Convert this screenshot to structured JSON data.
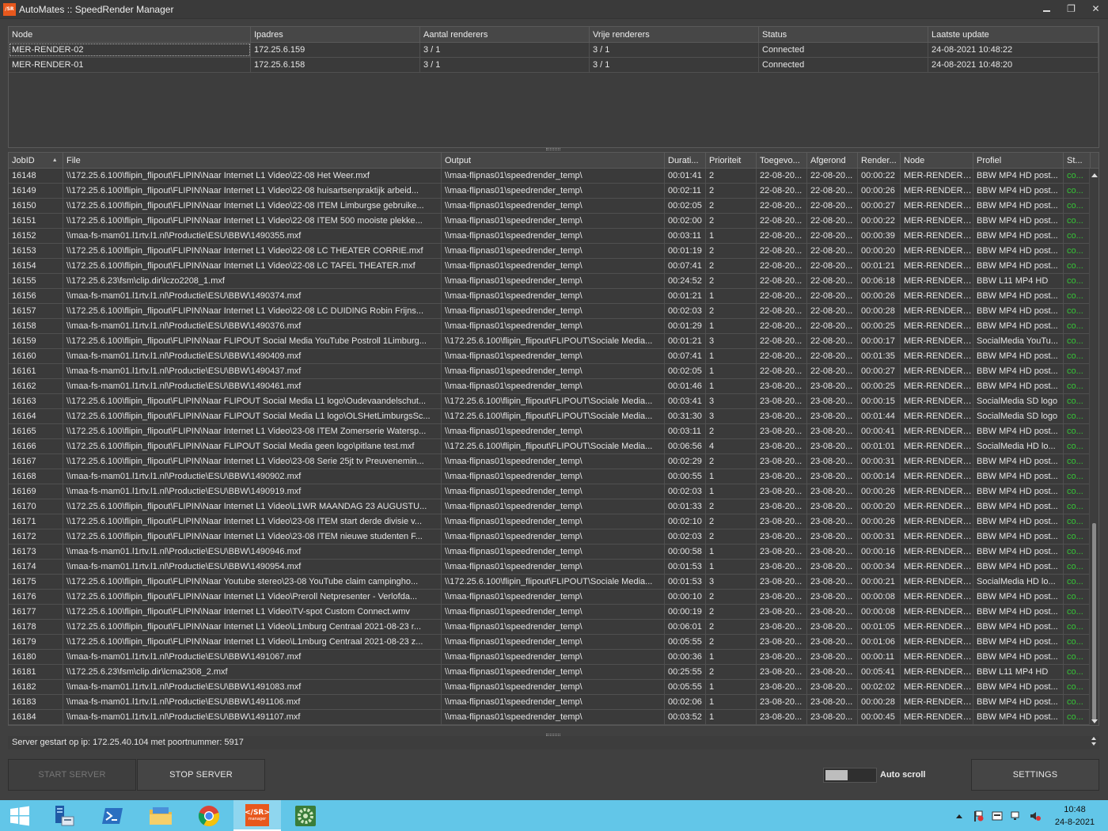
{
  "window": {
    "app_icon_text": "/SR",
    "title": "AutoMates :: SpeedRender Manager",
    "minimize": "—",
    "restore": "❐",
    "close": "✕"
  },
  "nodes": {
    "columns": [
      "Node",
      "Ipadres",
      "Aantal renderers",
      "Vrije renderers",
      "Status",
      "Laatste update"
    ],
    "rows": [
      [
        "MER-RENDER-02",
        "172.25.6.159",
        "3 / 1",
        "3 / 1",
        "Connected",
        "24-08-2021 10:48:22"
      ],
      [
        "MER-RENDER-01",
        "172.25.6.158",
        "3 / 1",
        "3 / 1",
        "Connected",
        "24-08-2021 10:48:20"
      ]
    ]
  },
  "jobs": {
    "sort_icon": "▲",
    "columns": [
      "JobID",
      "File",
      "Output",
      "Durati...",
      "Prioriteit",
      "Toegevo...",
      "Afgerond",
      "Render...",
      "Node",
      "Profiel",
      "St..."
    ],
    "rows": [
      [
        "16148",
        "\\\\172.25.6.100\\flipin_flipout\\FLIPIN\\Naar Internet L1 Video\\22-08 Het Weer.mxf",
        "\\\\maa-flipnas01\\speedrender_temp\\",
        "00:01:41",
        "2",
        "22-08-20...",
        "22-08-20...",
        "00:00:22",
        "MER-RENDER-...",
        "BBW MP4 HD post...",
        "co..."
      ],
      [
        "16149",
        "\\\\172.25.6.100\\flipin_flipout\\FLIPIN\\Naar Internet L1 Video\\22-08 huisartsenpraktijk arbeid...",
        "\\\\maa-flipnas01\\speedrender_temp\\",
        "00:02:11",
        "2",
        "22-08-20...",
        "22-08-20...",
        "00:00:26",
        "MER-RENDER-...",
        "BBW MP4 HD post...",
        "co..."
      ],
      [
        "16150",
        "\\\\172.25.6.100\\flipin_flipout\\FLIPIN\\Naar Internet L1 Video\\22-08 ITEM Limburgse gebruike...",
        "\\\\maa-flipnas01\\speedrender_temp\\",
        "00:02:05",
        "2",
        "22-08-20...",
        "22-08-20...",
        "00:00:27",
        "MER-RENDER-...",
        "BBW MP4 HD post...",
        "co..."
      ],
      [
        "16151",
        "\\\\172.25.6.100\\flipin_flipout\\FLIPIN\\Naar Internet L1 Video\\22-08 ITEM 500 mooiste plekke...",
        "\\\\maa-flipnas01\\speedrender_temp\\",
        "00:02:00",
        "2",
        "22-08-20...",
        "22-08-20...",
        "00:00:22",
        "MER-RENDER-...",
        "BBW MP4 HD post...",
        "co..."
      ],
      [
        "16152",
        "\\\\maa-fs-mam01.l1rtv.l1.nl\\Productie\\ESU\\BBW\\1490355.mxf",
        "\\\\maa-flipnas01\\speedrender_temp\\",
        "00:03:11",
        "1",
        "22-08-20...",
        "22-08-20...",
        "00:00:39",
        "MER-RENDER-...",
        "BBW MP4 HD post...",
        "co..."
      ],
      [
        "16153",
        "\\\\172.25.6.100\\flipin_flipout\\FLIPIN\\Naar Internet L1 Video\\22-08 LC THEATER CORRIE.mxf",
        "\\\\maa-flipnas01\\speedrender_temp\\",
        "00:01:19",
        "2",
        "22-08-20...",
        "22-08-20...",
        "00:00:20",
        "MER-RENDER-...",
        "BBW MP4 HD post...",
        "co..."
      ],
      [
        "16154",
        "\\\\172.25.6.100\\flipin_flipout\\FLIPIN\\Naar Internet L1 Video\\22-08 LC TAFEL THEATER.mxf",
        "\\\\maa-flipnas01\\speedrender_temp\\",
        "00:07:41",
        "2",
        "22-08-20...",
        "22-08-20...",
        "00:01:21",
        "MER-RENDER-...",
        "BBW MP4 HD post...",
        "co..."
      ],
      [
        "16155",
        "\\\\172.25.6.23\\fsm\\clip.dir\\lczo2208_1.mxf",
        "\\\\maa-flipnas01\\speedrender_temp\\",
        "00:24:52",
        "2",
        "22-08-20...",
        "22-08-20...",
        "00:06:18",
        "MER-RENDER-...",
        "BBW L11 MP4 HD",
        "co..."
      ],
      [
        "16156",
        "\\\\maa-fs-mam01.l1rtv.l1.nl\\Productie\\ESU\\BBW\\1490374.mxf",
        "\\\\maa-flipnas01\\speedrender_temp\\",
        "00:01:21",
        "1",
        "22-08-20...",
        "22-08-20...",
        "00:00:26",
        "MER-RENDER-...",
        "BBW MP4 HD post...",
        "co..."
      ],
      [
        "16157",
        "\\\\172.25.6.100\\flipin_flipout\\FLIPIN\\Naar Internet L1 Video\\22-08 LC DUIDING Robin Frijns...",
        "\\\\maa-flipnas01\\speedrender_temp\\",
        "00:02:03",
        "2",
        "22-08-20...",
        "22-08-20...",
        "00:00:28",
        "MER-RENDER-...",
        "BBW MP4 HD post...",
        "co..."
      ],
      [
        "16158",
        "\\\\maa-fs-mam01.l1rtv.l1.nl\\Productie\\ESU\\BBW\\1490376.mxf",
        "\\\\maa-flipnas01\\speedrender_temp\\",
        "00:01:29",
        "1",
        "22-08-20...",
        "22-08-20...",
        "00:00:25",
        "MER-RENDER-...",
        "BBW MP4 HD post...",
        "co..."
      ],
      [
        "16159",
        "\\\\172.25.6.100\\flipin_flipout\\FLIPIN\\Naar FLIPOUT Social Media YouTube Postroll 1Limburg...",
        "\\\\172.25.6.100\\flipin_flipout\\FLIPOUT\\Sociale Media...",
        "00:01:21",
        "3",
        "22-08-20...",
        "22-08-20...",
        "00:00:17",
        "MER-RENDER-...",
        "SocialMedia YouTu...",
        "co..."
      ],
      [
        "16160",
        "\\\\maa-fs-mam01.l1rtv.l1.nl\\Productie\\ESU\\BBW\\1490409.mxf",
        "\\\\maa-flipnas01\\speedrender_temp\\",
        "00:07:41",
        "1",
        "22-08-20...",
        "22-08-20...",
        "00:01:35",
        "MER-RENDER-...",
        "BBW MP4 HD post...",
        "co..."
      ],
      [
        "16161",
        "\\\\maa-fs-mam01.l1rtv.l1.nl\\Productie\\ESU\\BBW\\1490437.mxf",
        "\\\\maa-flipnas01\\speedrender_temp\\",
        "00:02:05",
        "1",
        "22-08-20...",
        "22-08-20...",
        "00:00:27",
        "MER-RENDER-...",
        "BBW MP4 HD post...",
        "co..."
      ],
      [
        "16162",
        "\\\\maa-fs-mam01.l1rtv.l1.nl\\Productie\\ESU\\BBW\\1490461.mxf",
        "\\\\maa-flipnas01\\speedrender_temp\\",
        "00:01:46",
        "1",
        "23-08-20...",
        "23-08-20...",
        "00:00:25",
        "MER-RENDER-...",
        "BBW MP4 HD post...",
        "co..."
      ],
      [
        "16163",
        "\\\\172.25.6.100\\flipin_flipout\\FLIPIN\\Naar FLIPOUT Social Media L1 logo\\Oudevaandelschut...",
        "\\\\172.25.6.100\\flipin_flipout\\FLIPOUT\\Sociale Media...",
        "00:03:41",
        "3",
        "23-08-20...",
        "23-08-20...",
        "00:00:15",
        "MER-RENDER-...",
        "SocialMedia SD logo",
        "co..."
      ],
      [
        "16164",
        "\\\\172.25.6.100\\flipin_flipout\\FLIPIN\\Naar FLIPOUT Social Media L1 logo\\OLSHetLimburgsSc...",
        "\\\\172.25.6.100\\flipin_flipout\\FLIPOUT\\Sociale Media...",
        "00:31:30",
        "3",
        "23-08-20...",
        "23-08-20...",
        "00:01:44",
        "MER-RENDER-...",
        "SocialMedia SD logo",
        "co..."
      ],
      [
        "16165",
        "\\\\172.25.6.100\\flipin_flipout\\FLIPIN\\Naar Internet L1 Video\\23-08 ITEM Zomerserie Watersp...",
        "\\\\maa-flipnas01\\speedrender_temp\\",
        "00:03:11",
        "2",
        "23-08-20...",
        "23-08-20...",
        "00:00:41",
        "MER-RENDER-...",
        "BBW MP4 HD post...",
        "co..."
      ],
      [
        "16166",
        "\\\\172.25.6.100\\flipin_flipout\\FLIPIN\\Naar FLIPOUT Social Media geen logo\\pitlane test.mxf",
        "\\\\172.25.6.100\\flipin_flipout\\FLIPOUT\\Sociale Media...",
        "00:06:56",
        "4",
        "23-08-20...",
        "23-08-20...",
        "00:01:01",
        "MER-RENDER-...",
        "SocialMedia HD lo...",
        "co..."
      ],
      [
        "16167",
        "\\\\172.25.6.100\\flipin_flipout\\FLIPIN\\Naar Internet L1 Video\\23-08 Serie 25jt tv Preuvenemin...",
        "\\\\maa-flipnas01\\speedrender_temp\\",
        "00:02:29",
        "2",
        "23-08-20...",
        "23-08-20...",
        "00:00:31",
        "MER-RENDER-...",
        "BBW MP4 HD post...",
        "co..."
      ],
      [
        "16168",
        "\\\\maa-fs-mam01.l1rtv.l1.nl\\Productie\\ESU\\BBW\\1490902.mxf",
        "\\\\maa-flipnas01\\speedrender_temp\\",
        "00:00:55",
        "1",
        "23-08-20...",
        "23-08-20...",
        "00:00:14",
        "MER-RENDER-...",
        "BBW MP4 HD post...",
        "co..."
      ],
      [
        "16169",
        "\\\\maa-fs-mam01.l1rtv.l1.nl\\Productie\\ESU\\BBW\\1490919.mxf",
        "\\\\maa-flipnas01\\speedrender_temp\\",
        "00:02:03",
        "1",
        "23-08-20...",
        "23-08-20...",
        "00:00:26",
        "MER-RENDER-...",
        "BBW MP4 HD post...",
        "co..."
      ],
      [
        "16170",
        "\\\\172.25.6.100\\flipin_flipout\\FLIPIN\\Naar Internet L1 Video\\L1WR MAANDAG 23 AUGUSTU...",
        "\\\\maa-flipnas01\\speedrender_temp\\",
        "00:01:33",
        "2",
        "23-08-20...",
        "23-08-20...",
        "00:00:20",
        "MER-RENDER-...",
        "BBW MP4 HD post...",
        "co..."
      ],
      [
        "16171",
        "\\\\172.25.6.100\\flipin_flipout\\FLIPIN\\Naar Internet L1 Video\\23-08 ITEM start derde divisie v...",
        "\\\\maa-flipnas01\\speedrender_temp\\",
        "00:02:10",
        "2",
        "23-08-20...",
        "23-08-20...",
        "00:00:26",
        "MER-RENDER-...",
        "BBW MP4 HD post...",
        "co..."
      ],
      [
        "16172",
        "\\\\172.25.6.100\\flipin_flipout\\FLIPIN\\Naar Internet L1 Video\\23-08 ITEM nieuwe studenten F...",
        "\\\\maa-flipnas01\\speedrender_temp\\",
        "00:02:03",
        "2",
        "23-08-20...",
        "23-08-20...",
        "00:00:31",
        "MER-RENDER-...",
        "BBW MP4 HD post...",
        "co..."
      ],
      [
        "16173",
        "\\\\maa-fs-mam01.l1rtv.l1.nl\\Productie\\ESU\\BBW\\1490946.mxf",
        "\\\\maa-flipnas01\\speedrender_temp\\",
        "00:00:58",
        "1",
        "23-08-20...",
        "23-08-20...",
        "00:00:16",
        "MER-RENDER-...",
        "BBW MP4 HD post...",
        "co..."
      ],
      [
        "16174",
        "\\\\maa-fs-mam01.l1rtv.l1.nl\\Productie\\ESU\\BBW\\1490954.mxf",
        "\\\\maa-flipnas01\\speedrender_temp\\",
        "00:01:53",
        "1",
        "23-08-20...",
        "23-08-20...",
        "00:00:34",
        "MER-RENDER-...",
        "BBW MP4 HD post...",
        "co..."
      ],
      [
        "16175",
        "\\\\172.25.6.100\\flipin_flipout\\FLIPIN\\Naar Youtube stereo\\23-08 YouTube claim campingho...",
        "\\\\172.25.6.100\\flipin_flipout\\FLIPOUT\\Sociale Media...",
        "00:01:53",
        "3",
        "23-08-20...",
        "23-08-20...",
        "00:00:21",
        "MER-RENDER-...",
        "SocialMedia HD lo...",
        "co..."
      ],
      [
        "16176",
        "\\\\172.25.6.100\\flipin_flipout\\FLIPIN\\Naar Internet L1 Video\\Preroll Netpresenter - Verlofda...",
        "\\\\maa-flipnas01\\speedrender_temp\\",
        "00:00:10",
        "2",
        "23-08-20...",
        "23-08-20...",
        "00:00:08",
        "MER-RENDER-...",
        "BBW MP4 HD post...",
        "co..."
      ],
      [
        "16177",
        "\\\\172.25.6.100\\flipin_flipout\\FLIPIN\\Naar Internet L1 Video\\TV-spot Custom Connect.wmv",
        "\\\\maa-flipnas01\\speedrender_temp\\",
        "00:00:19",
        "2",
        "23-08-20...",
        "23-08-20...",
        "00:00:08",
        "MER-RENDER-...",
        "BBW MP4 HD post...",
        "co..."
      ],
      [
        "16178",
        "\\\\172.25.6.100\\flipin_flipout\\FLIPIN\\Naar Internet L1 Video\\L1mburg Centraal 2021-08-23 r...",
        "\\\\maa-flipnas01\\speedrender_temp\\",
        "00:06:01",
        "2",
        "23-08-20...",
        "23-08-20...",
        "00:01:05",
        "MER-RENDER-...",
        "BBW MP4 HD post...",
        "co..."
      ],
      [
        "16179",
        "\\\\172.25.6.100\\flipin_flipout\\FLIPIN\\Naar Internet L1 Video\\L1mburg Centraal 2021-08-23 z...",
        "\\\\maa-flipnas01\\speedrender_temp\\",
        "00:05:55",
        "2",
        "23-08-20...",
        "23-08-20...",
        "00:01:06",
        "MER-RENDER-...",
        "BBW MP4 HD post...",
        "co..."
      ],
      [
        "16180",
        "\\\\maa-fs-mam01.l1rtv.l1.nl\\Productie\\ESU\\BBW\\1491067.mxf",
        "\\\\maa-flipnas01\\speedrender_temp\\",
        "00:00:36",
        "1",
        "23-08-20...",
        "23-08-20...",
        "00:00:11",
        "MER-RENDER-...",
        "BBW MP4 HD post...",
        "co..."
      ],
      [
        "16181",
        "\\\\172.25.6.23\\fsm\\clip.dir\\lcma2308_2.mxf",
        "\\\\maa-flipnas01\\speedrender_temp\\",
        "00:25:55",
        "2",
        "23-08-20...",
        "23-08-20...",
        "00:05:41",
        "MER-RENDER-...",
        "BBW L11 MP4 HD",
        "co..."
      ],
      [
        "16182",
        "\\\\maa-fs-mam01.l1rtv.l1.nl\\Productie\\ESU\\BBW\\1491083.mxf",
        "\\\\maa-flipnas01\\speedrender_temp\\",
        "00:05:55",
        "1",
        "23-08-20...",
        "23-08-20...",
        "00:02:02",
        "MER-RENDER-...",
        "BBW MP4 HD post...",
        "co..."
      ],
      [
        "16183",
        "\\\\maa-fs-mam01.l1rtv.l1.nl\\Productie\\ESU\\BBW\\1491106.mxf",
        "\\\\maa-flipnas01\\speedrender_temp\\",
        "00:02:06",
        "1",
        "23-08-20...",
        "23-08-20...",
        "00:00:28",
        "MER-RENDER-...",
        "BBW MP4 HD post...",
        "co..."
      ],
      [
        "16184",
        "\\\\maa-fs-mam01.l1rtv.l1.nl\\Productie\\ESU\\BBW\\1491107.mxf",
        "\\\\maa-flipnas01\\speedrender_temp\\",
        "00:03:52",
        "1",
        "23-08-20...",
        "23-08-20...",
        "00:00:45",
        "MER-RENDER-...",
        "BBW MP4 HD post...",
        "co..."
      ]
    ]
  },
  "log": {
    "text": "Server gestart op ip: 172.25.40.104 met poortnummer: 5917"
  },
  "controls": {
    "start_server": "START SERVER",
    "stop_server": "STOP SERVER",
    "auto_scroll_label": "Auto scroll",
    "auto_scroll_on": false,
    "settings": "SETTINGS"
  },
  "taskbar": {
    "srm_icon_text": "</SR>",
    "srm_icon_subtext": "manager",
    "time": "10:48",
    "date": "24-8-2021"
  },
  "colors": {
    "status_ok": "#35c435",
    "srm_brand": "#e8581d",
    "taskbar": "#62c6e8"
  }
}
